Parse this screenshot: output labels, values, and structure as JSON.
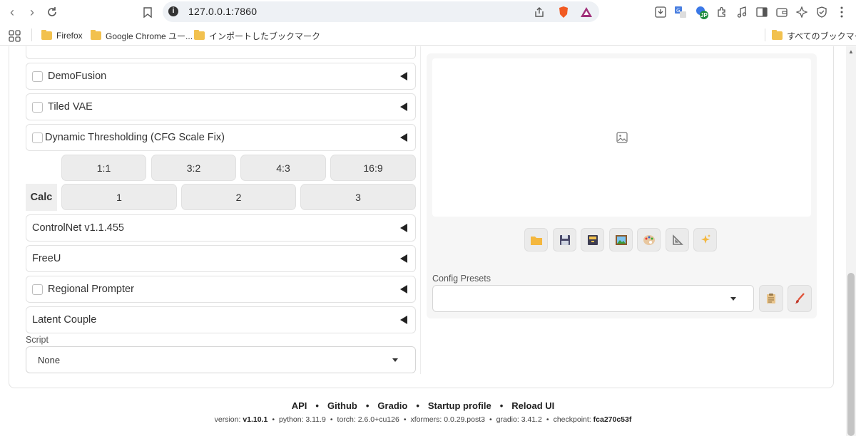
{
  "browser": {
    "url": "127.0.0.1:7860",
    "profile_badge": "JP",
    "bookmarks": [
      "Firefox",
      "Google Chrome ユー...",
      "インポートしたブックマーク"
    ],
    "all_bookmarks": "すべてのブックマーク"
  },
  "left": {
    "accordions": [
      {
        "label": "DemoFusion",
        "checkbox": true
      },
      {
        "label": "Tiled VAE",
        "checkbox": true
      },
      {
        "label": "Dynamic Thresholding (CFG Scale Fix)",
        "checkbox": true
      }
    ],
    "ratios": [
      "1:1",
      "3:2",
      "4:3",
      "16:9"
    ],
    "calc": {
      "label": "Calc",
      "buttons": [
        "1",
        "2",
        "3"
      ]
    },
    "accordions2": [
      {
        "label": "ControlNet v1.1.455",
        "checkbox": false
      },
      {
        "label": "FreeU",
        "checkbox": false
      },
      {
        "label": "Regional Prompter",
        "checkbox": true
      },
      {
        "label": "Latent Couple",
        "checkbox": false
      }
    ],
    "script": {
      "label": "Script",
      "value": "None"
    }
  },
  "right": {
    "tool_icons": [
      "folder-icon",
      "floppy-disk-icon",
      "archive-box-icon",
      "picture-icon",
      "palette-icon",
      "triangle-ruler-icon",
      "sparkles-icon"
    ],
    "config_presets": {
      "label": "Config Presets",
      "value": ""
    }
  },
  "footer": {
    "links": [
      "API",
      "Github",
      "Gradio",
      "Startup profile",
      "Reload UI"
    ],
    "versions": [
      {
        "key": "version:",
        "value": "v1.10.1",
        "bold": true
      },
      {
        "key": "python:",
        "value": "3.11.9",
        "bold": false
      },
      {
        "key": "torch:",
        "value": "2.6.0+cu126",
        "bold": false
      },
      {
        "key": "xformers:",
        "value": "0.0.29.post3",
        "bold": false
      },
      {
        "key": "gradio:",
        "value": "3.41.2",
        "bold": false
      },
      {
        "key": "checkpoint:",
        "value": "fca270c53f",
        "bold": true
      }
    ]
  }
}
